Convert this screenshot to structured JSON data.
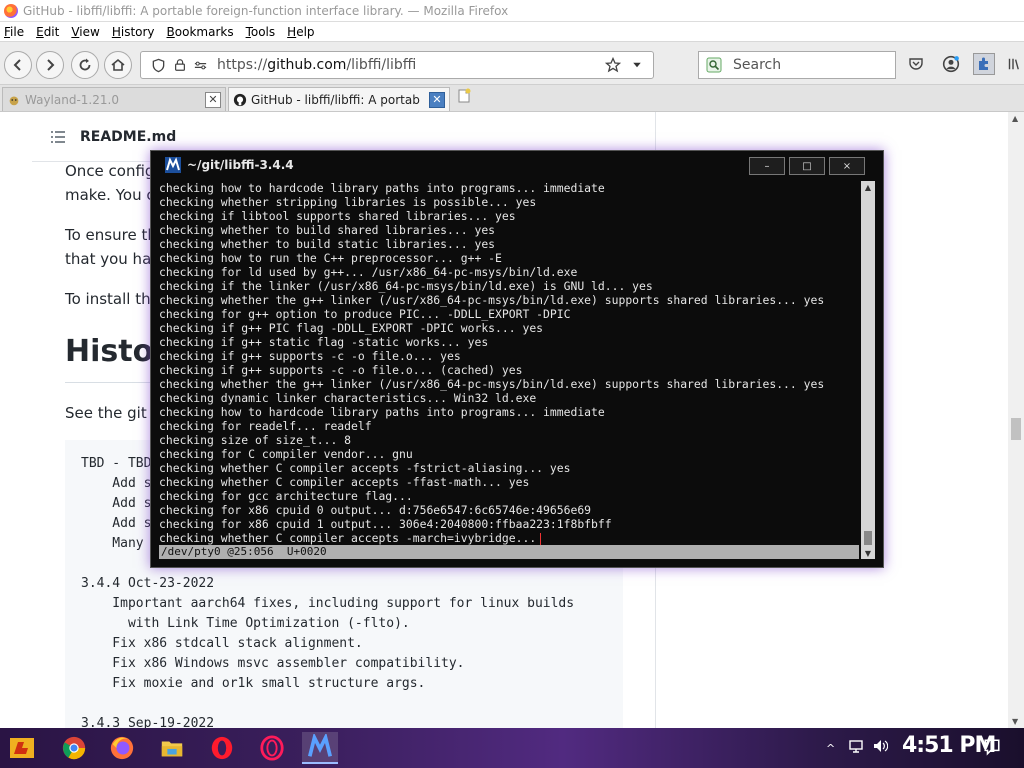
{
  "window": {
    "title": "GitHub - libffi/libffi: A portable foreign-function interface library. — Mozilla Firefox"
  },
  "menu": [
    {
      "label": "File",
      "key": "F",
      "rest": "ile"
    },
    {
      "label": "Edit",
      "key": "E",
      "rest": "dit"
    },
    {
      "label": "View",
      "key": "V",
      "rest": "iew"
    },
    {
      "label": "History",
      "key": "H",
      "rest": "istory"
    },
    {
      "label": "Bookmarks",
      "key": "B",
      "rest": "ookmarks"
    },
    {
      "label": "Tools",
      "key": "T",
      "rest": "ools"
    },
    {
      "label": "Help",
      "key": "H",
      "rest": "elp"
    }
  ],
  "navbar": {
    "url_scheme": "https://",
    "url_host": "github.com",
    "url_path": "/libffi/libffi",
    "search_placeholder": "Search"
  },
  "tabs": [
    {
      "label": "Wayland-1.21.0",
      "active": false
    },
    {
      "label": "GitHub - libffi/libffi: A portab",
      "active": true
    }
  ],
  "page": {
    "readme_filename": "README.md",
    "para1_line1": "Once config",
    "para1_line2": "make. You ca",
    "para2_line1": "To ensure th",
    "para2_line2": "that you hav",
    "para3": "To install the",
    "history_heading": "Histo",
    "see_git": "See the git lo",
    "code_lines": [
      "TBD - TBD",
      "    Add s",
      "    Add s",
      "    Add s",
      "    Many ",
      "",
      "3.4.4 Oct-23-2022",
      "    Important aarch64 fixes, including support for linux builds",
      "      with Link Time Optimization (-flto).",
      "    Fix x86 stdcall stack alignment.",
      "    Fix x86 Windows msvc assembler compatibility.",
      "    Fix moxie and or1k small structure args.",
      "",
      "3.4.3 Sep-19-2022"
    ]
  },
  "terminal": {
    "title": "~/git/libffi-3.4.4",
    "controls": {
      "minimize": "–",
      "maximize": "□",
      "close": "×"
    },
    "lines": [
      "checking how to hardcode library paths into programs... immediate",
      "checking whether stripping libraries is possible... yes",
      "checking if libtool supports shared libraries... yes",
      "checking whether to build shared libraries... yes",
      "checking whether to build static libraries... yes",
      "checking how to run the C++ preprocessor... g++ -E",
      "checking for ld used by g++... /usr/x86_64-pc-msys/bin/ld.exe",
      "checking if the linker (/usr/x86_64-pc-msys/bin/ld.exe) is GNU ld... yes",
      "checking whether the g++ linker (/usr/x86_64-pc-msys/bin/ld.exe) supports shared libraries... yes",
      "checking for g++ option to produce PIC... -DDLL_EXPORT -DPIC",
      "checking if g++ PIC flag -DDLL_EXPORT -DPIC works... yes",
      "checking if g++ static flag -static works... yes",
      "checking if g++ supports -c -o file.o... yes",
      "checking if g++ supports -c -o file.o... (cached) yes",
      "checking whether the g++ linker (/usr/x86_64-pc-msys/bin/ld.exe) supports shared libraries... yes",
      "checking dynamic linker characteristics... Win32 ld.exe",
      "checking how to hardcode library paths into programs... immediate",
      "checking for readelf... readelf",
      "checking size of size_t... 8",
      "checking for C compiler vendor... gnu",
      "checking whether C compiler accepts -fstrict-aliasing... yes",
      "checking whether C compiler accepts -ffast-math... yes",
      "checking for gcc architecture flag...",
      "checking for x86 cpuid 0 output... d:756e6547:6c65746e:49656e69",
      "checking for x86 cpuid 1 output... 306e4:2040800:ffbaa223:1f8bfbff",
      "checking whether C compiler accepts -march=ivybridge..."
    ],
    "status": "/dev/pty0 @25:056  U+0020"
  },
  "taskbar": {
    "items": [
      "start-menu",
      "chrome",
      "firefox",
      "file-explorer",
      "opera",
      "opera-gx",
      "mintty"
    ],
    "clock": "4:51 PM"
  },
  "colors": {
    "terminal_bg": "#0c0c0c",
    "terminal_fg": "#e6e6e6",
    "taskbar": "#3a1f5c",
    "link_active_close": "#4a7fc1"
  }
}
